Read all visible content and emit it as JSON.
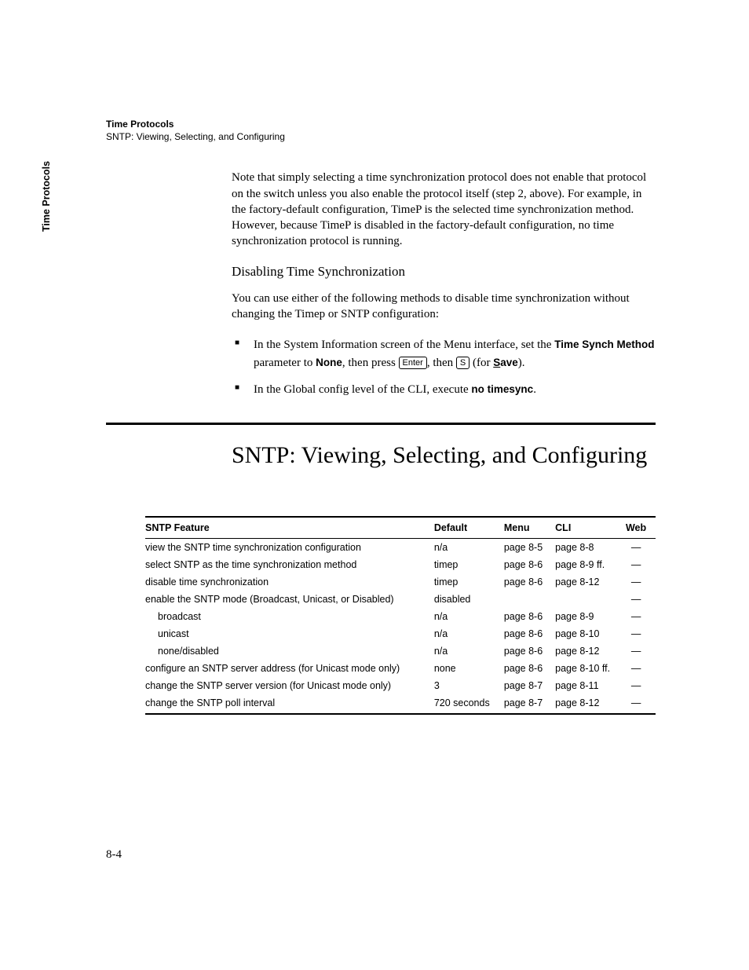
{
  "header": {
    "title": "Time Protocols",
    "subtitle": "SNTP: Viewing, Selecting, and Configuring"
  },
  "sidetab": "Time Protocols",
  "p1": "Note that simply selecting a time synchronization protocol does not enable that protocol on the switch unless you also enable the protocol itself (step 2, above). For example, in the factory-default configuration, TimeP is the selected time synchronization method. However, because TimeP is disabled in the factory-default configuration, no time synchronization protocol is running.",
  "subhead": "Disabling Time Synchronization",
  "p2": "You can use either of the following methods to disable time synchronization without changing the Timep or SNTP configuration:",
  "b1": {
    "pre": "In the System Information screen of the Menu interface, set the ",
    "b1a": "Time Synch Method",
    "mid1": " parameter to ",
    "b1b": "None",
    "mid2": ", then press ",
    "key1": "Enter",
    "mid3": ", then ",
    "key2": "S",
    "mid4": " (for ",
    "b1c_u": "S",
    "b1c_rest": "ave",
    "end": ")."
  },
  "b2": {
    "pre": "In the Global config level of the CLI, execute ",
    "code": "no timesync",
    "end": "."
  },
  "section_title": "SNTP: Viewing, Selecting, and Configuring",
  "table": {
    "headers": [
      "SNTP Feature",
      "Default",
      "Menu",
      "CLI",
      "Web"
    ],
    "rows": [
      {
        "f": "view the SNTP time synchronization configuration",
        "d": "n/a",
        "m": "page 8-5",
        "c": "page 8-8",
        "w": "—",
        "indent": false
      },
      {
        "f": "select SNTP as the time synchronization method",
        "d": "timep",
        "m": "page 8-6",
        "c": "page 8-9 ff.",
        "w": "—",
        "indent": false
      },
      {
        "f": "disable time synchronization",
        "d": "timep",
        "m": "page 8-6",
        "c": "page 8-12",
        "w": "—",
        "indent": false
      },
      {
        "f": "enable the SNTP mode (Broadcast, Unicast, or Disabled)",
        "d": "disabled",
        "m": "",
        "c": "",
        "w": "—",
        "indent": false
      },
      {
        "f": "broadcast",
        "d": "n/a",
        "m": "page 8-6",
        "c": "page 8-9",
        "w": "—",
        "indent": true
      },
      {
        "f": "unicast",
        "d": "n/a",
        "m": "page 8-6",
        "c": "page 8-10",
        "w": "—",
        "indent": true
      },
      {
        "f": "none/disabled",
        "d": "n/a",
        "m": "page 8-6",
        "c": "page 8-12",
        "w": "—",
        "indent": true
      },
      {
        "f": "configure an SNTP server address (for Unicast mode only)",
        "d": "none",
        "m": "page 8-6",
        "c": "page 8-10 ff.",
        "w": "—",
        "indent": false
      },
      {
        "f": "change the SNTP server version (for Unicast mode only)",
        "d": "3",
        "m": "page 8-7",
        "c": "page 8-11",
        "w": "—",
        "indent": false
      },
      {
        "f": "change the SNTP poll interval",
        "d": "720 seconds",
        "m": "page 8-7",
        "c": "page 8-12",
        "w": "—",
        "indent": false
      }
    ]
  },
  "page_num": "8-4"
}
